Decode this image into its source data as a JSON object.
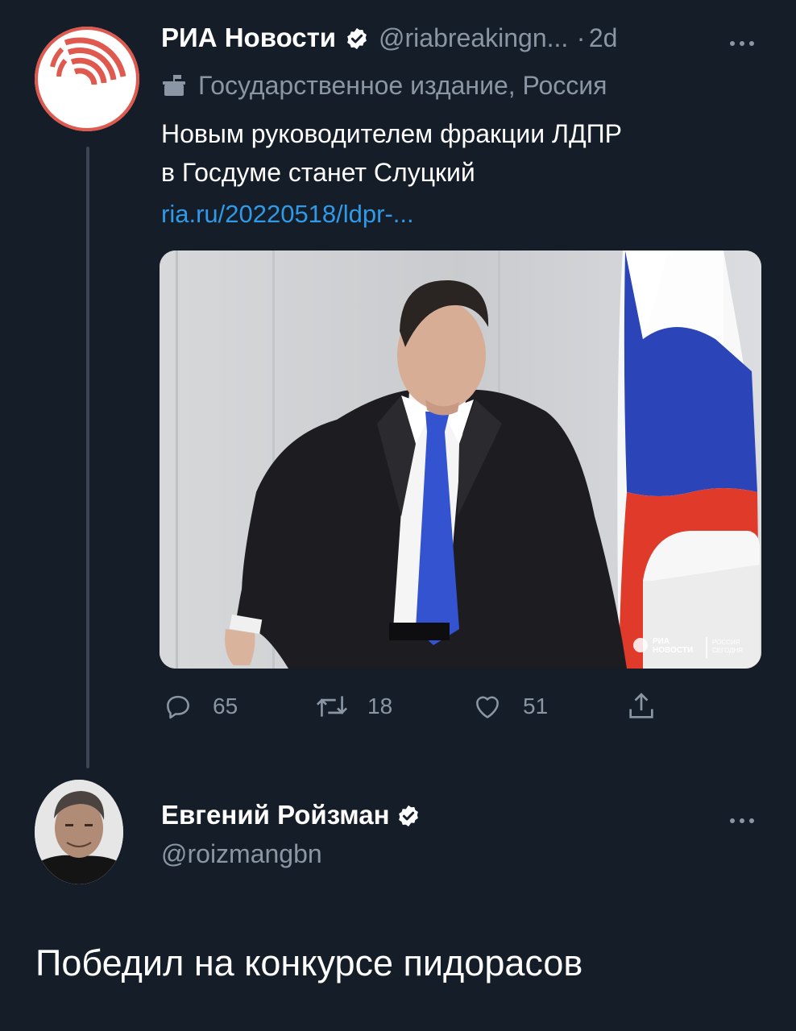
{
  "tweet": {
    "author_name": "РИА Новости",
    "handle": "@riabreakingn...",
    "separator": "·",
    "time": "2d",
    "label": "Государственное издание, Россия",
    "text_line1": "Новым руководителем фракции ЛДПР",
    "text_line2": "в Госдуме станет Слуцкий",
    "link": "ria.ru/20220518/ldpr-...",
    "media": {
      "watermark_left_line1": "РИА",
      "watermark_left_line2": "НОВОСТИ",
      "watermark_right_line1": "РОССИЯ",
      "watermark_right_line2": "СЕГОДНЯ"
    },
    "actions": {
      "replies": "65",
      "retweets": "18",
      "likes": "51"
    }
  },
  "reply": {
    "author_name": "Евгений Ройзман",
    "handle": "@roizmangbn",
    "text": "Победил на конкурсе пидорасов"
  },
  "icons": {
    "more": "more-icon",
    "verified": "verified-badge-icon",
    "state_media": "state-media-icon",
    "reply": "reply-icon",
    "retweet": "retweet-icon",
    "like": "like-icon",
    "share": "share-icon"
  },
  "colors": {
    "background": "#151d28",
    "text_muted": "#8a96a3",
    "link": "#2f9ae8",
    "ria_red": "#e0594f"
  }
}
